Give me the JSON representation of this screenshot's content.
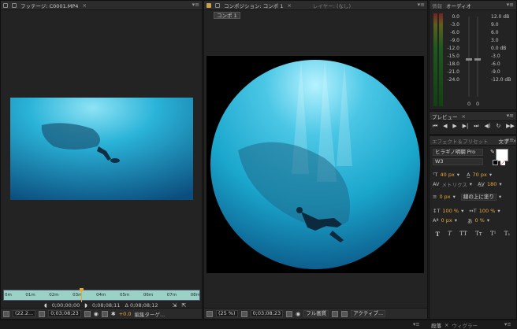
{
  "footage": {
    "tab_label": "フッテージ: C0001.MP4",
    "ruler": [
      "0m",
      "01m",
      "02m",
      "03m",
      "04m",
      "05m",
      "06m",
      "07m",
      "08m"
    ],
    "zoom": "(22.2...",
    "timecode": "0;03;08;23",
    "in_point": "0;00;00;00",
    "out_point": "0;08;08;11",
    "duration": "Δ 0;08;08;12",
    "exposure": "+0.0",
    "edit_target": "編集ターゲ..."
  },
  "composition": {
    "tab_label": "コンポジション: コンポ 1",
    "layer_tab": "レイヤー: (なし)",
    "subtab": "コンポ 1",
    "zoom": "(25 %)",
    "timecode": "0;03;08;23",
    "quality": "フル画質",
    "view": "アクティブ..."
  },
  "info_tab": "情報",
  "audio": {
    "tab_label": "オーディオ",
    "left_scale": [
      "0.0",
      "-3.0",
      "-6.0",
      "-9.0",
      "-12.0",
      "-15.0",
      "-18.0",
      "-21.0",
      "-24.0"
    ],
    "right_db": [
      "12.0 dB",
      "9.0",
      "6.0",
      "3.0",
      "0.0 dB",
      "-3.0",
      "-6.0",
      "-9.0",
      "-12.0 dB"
    ],
    "slider_zero_left": "0",
    "slider_zero_right": "0"
  },
  "preview": {
    "tab_label": "プレビュー"
  },
  "effects": {
    "tab_label": "エフェクト＆プリセット"
  },
  "character": {
    "tab_label": "文字",
    "font_family": "ヒラギノ明朝 Pro",
    "font_style": "W3",
    "font_size": "40 px",
    "leading": "70 px",
    "kerning": "メトリクス",
    "tracking": "180",
    "stroke_width": "0 px",
    "stroke_type": "線の上に塗り",
    "vertical_scale": "100 %",
    "horizontal_scale": "100 %",
    "baseline_shift": "0 px",
    "tsume": "0 %",
    "style_buttons": [
      "T",
      "T",
      "TT",
      "Tт",
      "T¹",
      "T₁"
    ]
  },
  "bottom": {
    "paragraph_tab": "段落",
    "wiggler_tab": "ウィグラー"
  },
  "colors": {
    "accent": "#e7a838",
    "timeline_teal": "#9ad1c5",
    "water_light": "#1aa6cc",
    "water_dark": "#0a4f80"
  }
}
